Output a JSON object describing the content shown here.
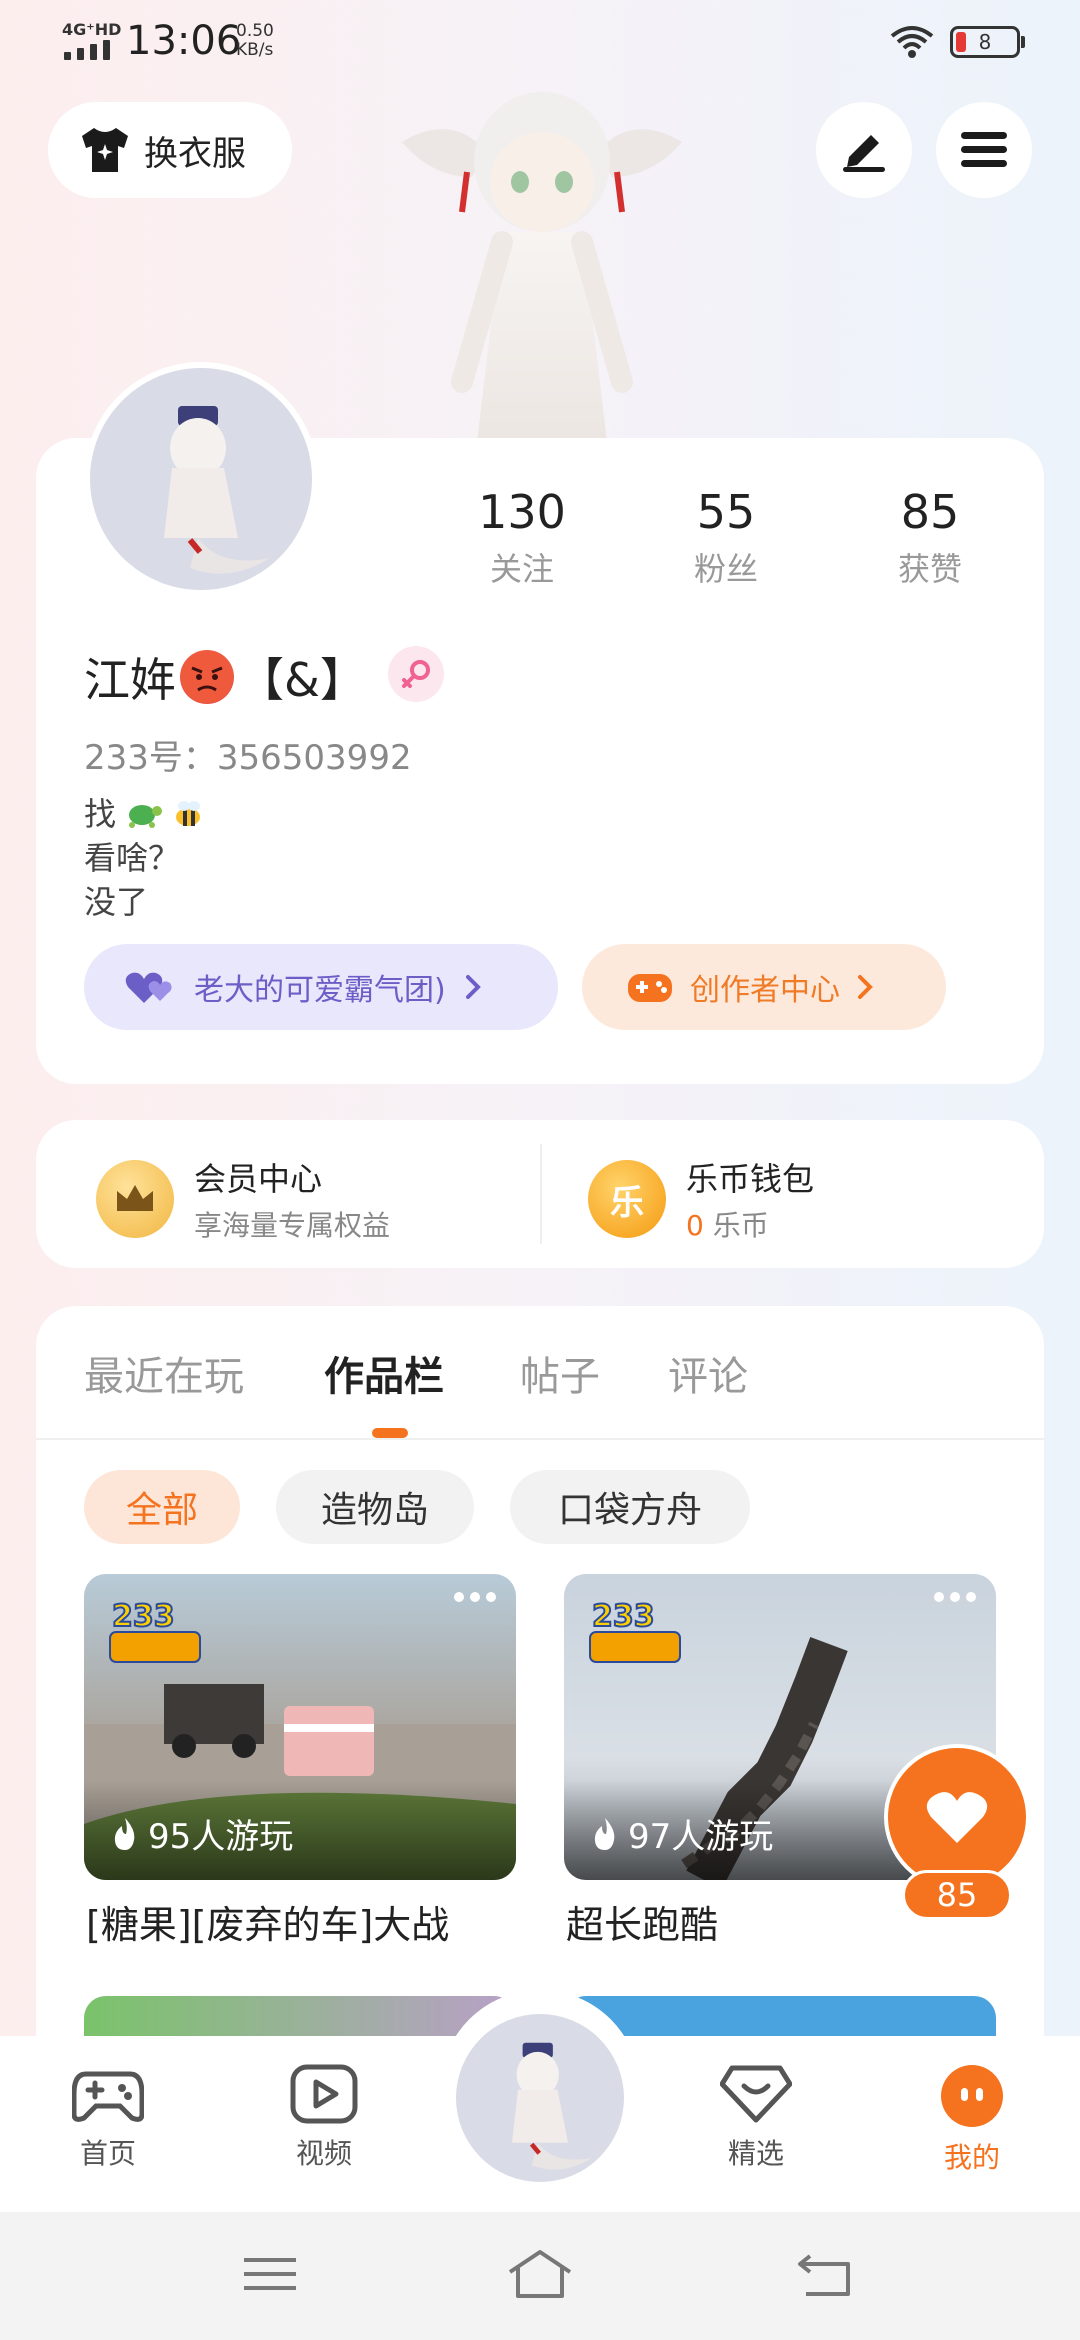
{
  "status_bar": {
    "network": "4G⁺HD",
    "time": "13:06",
    "speed_value": "0.50",
    "speed_unit": "KB/s",
    "battery": "8"
  },
  "header": {
    "outfit_label": "换衣服"
  },
  "profile": {
    "stats": [
      {
        "value": "130",
        "label": "关注"
      },
      {
        "value": "55",
        "label": "粉丝"
      },
      {
        "value": "85",
        "label": "获赞"
      }
    ],
    "name_prefix": "江姩",
    "name_suffix": "【&】",
    "uid": "233号：356503992",
    "bio_line1": "找",
    "bio_line2": "看啥？",
    "bio_line3": "没了",
    "fan_group": "老大的可爱霸气团)",
    "creator_center": "创作者中心"
  },
  "membership": {
    "vip_title": "会员中心",
    "vip_sub": "享海量专属权益",
    "wallet_title": "乐币钱包",
    "wallet_amount": "0",
    "wallet_unit": "乐币",
    "coin_glyph": "乐"
  },
  "works": {
    "tabs": [
      "最近在玩",
      "作品栏",
      "帖子",
      "评论"
    ],
    "filters": [
      "全部",
      "造物岛",
      "口袋方舟"
    ],
    "items": [
      {
        "logo": "233\n造物岛",
        "plays": "95人游玩",
        "title": "[糖果][废弃的车]大战"
      },
      {
        "logo": "233\n造物岛",
        "plays": "97人游玩",
        "title": "超长跑酷"
      }
    ],
    "likes": "85"
  },
  "bottom_nav": {
    "items": [
      {
        "label": "首页"
      },
      {
        "label": "视频"
      },
      {
        "label": "精选"
      },
      {
        "label": "我的"
      }
    ]
  },
  "colors": {
    "accent": "#f5731f",
    "purple": "#6b5fc7"
  }
}
